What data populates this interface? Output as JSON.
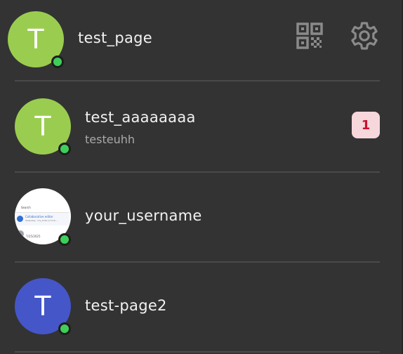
{
  "colors": {
    "background": "#333333",
    "divider": "#4a4a4a",
    "online": "#3ecf5a",
    "badge_bg": "#f6d7dc",
    "badge_text": "#c8102e",
    "icon": "#8a8a8a"
  },
  "header": {
    "avatar_letter": "T",
    "avatar_color": "#9acd4f",
    "name": "test_page",
    "online": true,
    "qr_icon": "qr-code-icon",
    "settings_icon": "gear-icon"
  },
  "conversations": [
    {
      "avatar_letter": "T",
      "avatar_color": "#9acd4f",
      "name": "test_aaaaaaaa",
      "subtitle": "testeuhh",
      "unread": "1",
      "online": true
    },
    {
      "avatar_type": "screenshot",
      "avatar_text": {
        "search": "Search",
        "title": "Collaborative editor",
        "subtitle": "Yesterday - ms_3732 (ct 9 th...",
        "bottom": "7/25/2025"
      },
      "name": "your_username",
      "online": true
    },
    {
      "avatar_letter": "T",
      "avatar_color": "#4556c9",
      "name": "test-page2",
      "online": true
    }
  ]
}
